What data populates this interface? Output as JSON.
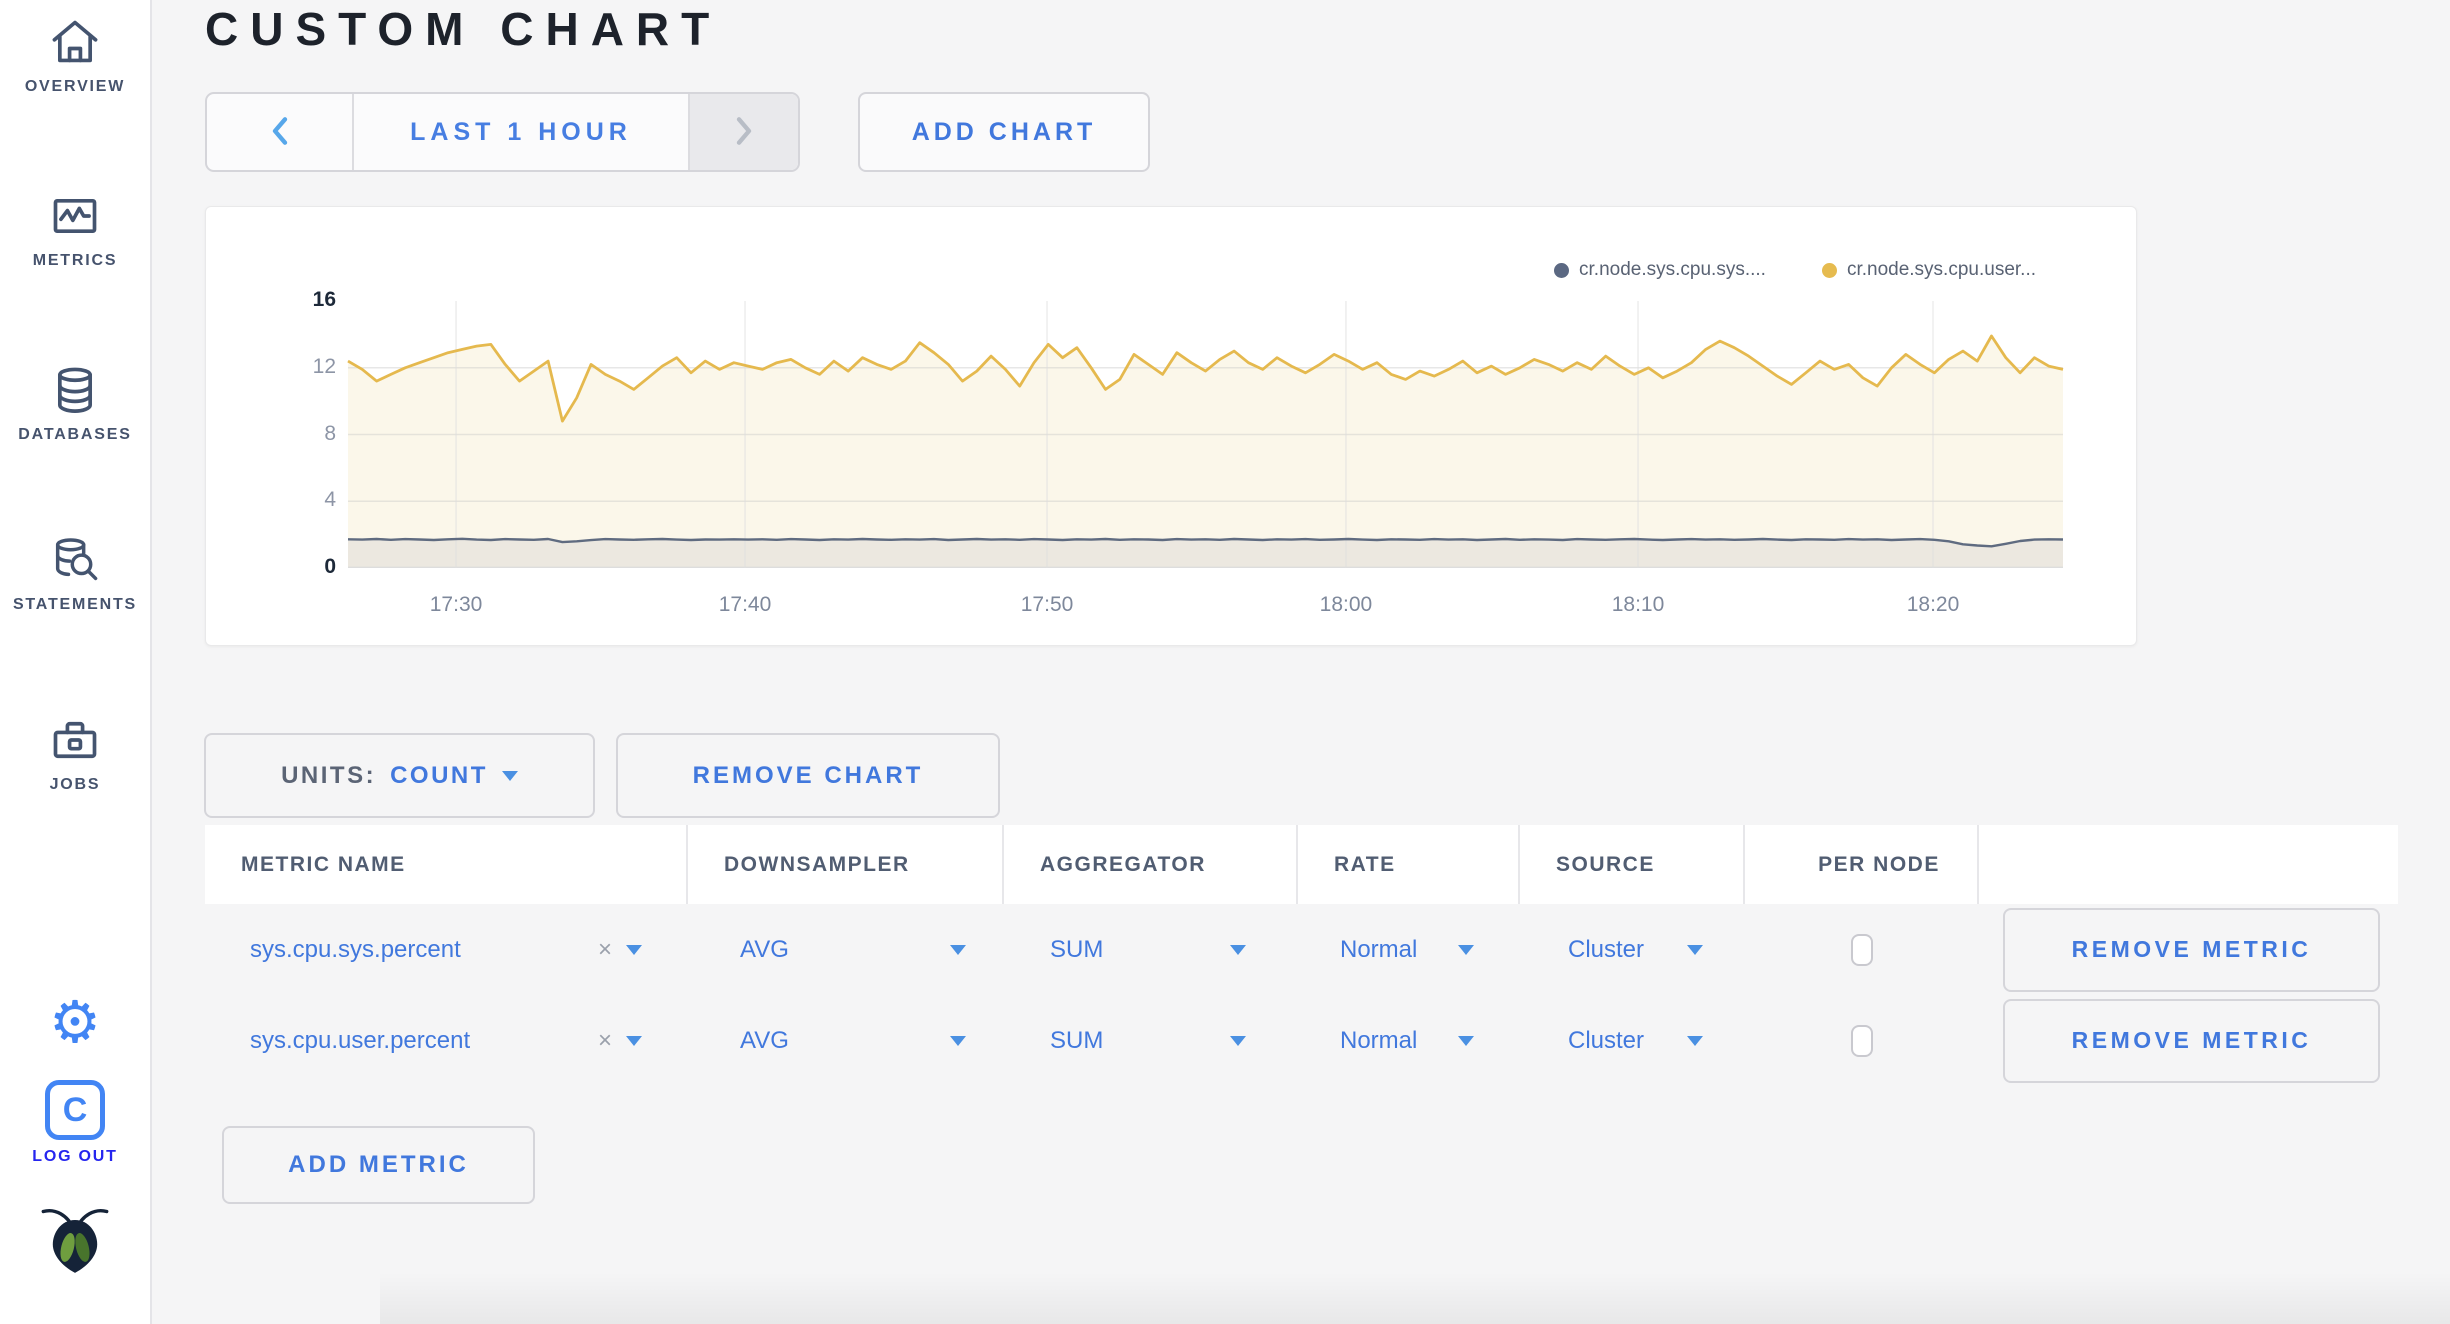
{
  "sidebar": {
    "items": [
      {
        "label": "OVERVIEW"
      },
      {
        "label": "METRICS"
      },
      {
        "label": "DATABASES"
      },
      {
        "label": "STATEMENTS"
      },
      {
        "label": "JOBS"
      }
    ],
    "log_out_label": "LOG OUT"
  },
  "header": {
    "title": "CUSTOM CHART",
    "time_range_label": "LAST 1 HOUR",
    "add_chart_label": "ADD CHART"
  },
  "chart_data": {
    "type": "line",
    "title": "",
    "xlabel": "",
    "ylabel": "",
    "ylim": [
      0,
      16
    ],
    "y_ticks": [
      0,
      4,
      8,
      12,
      16
    ],
    "grid": true,
    "legend_position": "top-right",
    "x_ticks": [
      {
        "label": "17:30",
        "pos": 0.063
      },
      {
        "label": "17:40",
        "pos": 0.2315
      },
      {
        "label": "17:50",
        "pos": 0.4076
      },
      {
        "label": "18:00",
        "pos": 0.5819
      },
      {
        "label": "18:10",
        "pos": 0.7522
      },
      {
        "label": "18:20",
        "pos": 0.9242
      }
    ],
    "series": [
      {
        "name": "cr.node.sys.cpu.sys....",
        "color": "#5b6882",
        "stroke": "#5f6b80",
        "fill": "#ece8e0",
        "values": [
          1.72,
          1.7,
          1.74,
          1.69,
          1.73,
          1.71,
          1.68,
          1.72,
          1.75,
          1.7,
          1.68,
          1.73,
          1.71,
          1.69,
          1.74,
          1.55,
          1.6,
          1.67,
          1.73,
          1.71,
          1.69,
          1.72,
          1.74,
          1.7,
          1.68,
          1.71,
          1.7,
          1.72,
          1.7,
          1.72,
          1.69,
          1.73,
          1.71,
          1.68,
          1.72,
          1.7,
          1.74,
          1.71,
          1.69,
          1.72,
          1.7,
          1.73,
          1.68,
          1.71,
          1.74,
          1.7,
          1.72,
          1.69,
          1.73,
          1.71,
          1.68,
          1.72,
          1.7,
          1.74,
          1.69,
          1.72,
          1.71,
          1.68,
          1.73,
          1.7,
          1.72,
          1.69,
          1.74,
          1.71,
          1.68,
          1.72,
          1.7,
          1.73,
          1.69,
          1.71,
          1.74,
          1.7,
          1.68,
          1.72,
          1.71,
          1.69,
          1.73,
          1.7,
          1.72,
          1.68,
          1.71,
          1.74,
          1.69,
          1.72,
          1.7,
          1.68,
          1.73,
          1.71,
          1.69,
          1.72,
          1.74,
          1.7,
          1.68,
          1.71,
          1.73,
          1.7,
          1.72,
          1.69,
          1.71,
          1.74,
          1.7,
          1.68,
          1.72,
          1.71,
          1.69,
          1.73,
          1.7,
          1.72,
          1.68,
          1.71,
          1.73,
          1.69,
          1.6,
          1.42,
          1.35,
          1.3,
          1.45,
          1.62,
          1.7,
          1.72,
          1.71
        ]
      },
      {
        "name": "cr.node.sys.cpu.user...",
        "color": "#e6bb4f",
        "stroke": "#e5b94e",
        "fill": "#fbf7ea",
        "values": [
          12.4,
          11.9,
          11.2,
          11.6,
          12.0,
          12.3,
          12.6,
          12.9,
          13.1,
          13.3,
          13.4,
          12.2,
          11.2,
          11.8,
          12.4,
          8.8,
          10.2,
          12.2,
          11.6,
          11.2,
          10.7,
          11.4,
          12.1,
          12.6,
          11.7,
          12.4,
          11.9,
          12.3,
          12.1,
          11.9,
          12.3,
          12.5,
          12.0,
          11.6,
          12.4,
          11.8,
          12.6,
          12.2,
          11.9,
          12.4,
          13.5,
          12.9,
          12.2,
          11.2,
          11.8,
          12.7,
          11.9,
          10.9,
          12.3,
          13.4,
          12.6,
          13.2,
          12.0,
          10.7,
          11.3,
          12.8,
          12.2,
          11.6,
          12.9,
          12.3,
          11.8,
          12.5,
          13.0,
          12.3,
          11.9,
          12.6,
          12.1,
          11.7,
          12.2,
          12.8,
          12.4,
          11.9,
          12.3,
          11.6,
          11.3,
          11.8,
          11.5,
          11.9,
          12.4,
          11.7,
          12.1,
          11.6,
          12.0,
          12.5,
          12.2,
          11.8,
          12.3,
          11.9,
          12.7,
          12.1,
          11.6,
          12.0,
          11.4,
          11.8,
          12.3,
          13.1,
          13.6,
          13.2,
          12.7,
          12.1,
          11.5,
          11.0,
          11.7,
          12.4,
          11.9,
          12.2,
          11.4,
          10.9,
          12.0,
          12.8,
          12.2,
          11.7,
          12.5,
          13.0,
          12.4,
          13.9,
          12.6,
          11.7,
          12.6,
          12.1,
          11.9
        ]
      }
    ]
  },
  "controls": {
    "units_label": "UNITS:",
    "units_value": "COUNT",
    "remove_chart_label": "REMOVE CHART",
    "add_metric_label": "ADD METRIC"
  },
  "table": {
    "columns": [
      "METRIC NAME",
      "DOWNSAMPLER",
      "AGGREGATOR",
      "RATE",
      "SOURCE",
      "PER NODE",
      ""
    ],
    "rows": [
      {
        "metric": "sys.cpu.sys.percent",
        "clear": "×",
        "downsampler": "AVG",
        "aggregator": "SUM",
        "rate": "Normal",
        "source": "Cluster",
        "per_node_checked": false,
        "remove_label": "REMOVE METRIC"
      },
      {
        "metric": "sys.cpu.user.percent",
        "clear": "×",
        "downsampler": "AVG",
        "aggregator": "SUM",
        "rate": "Normal",
        "source": "Cluster",
        "per_node_checked": false,
        "remove_label": "REMOVE METRIC"
      }
    ]
  }
}
